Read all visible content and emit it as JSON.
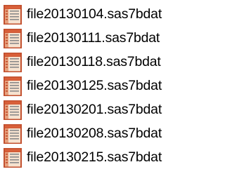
{
  "file_list": {
    "icon": "sas-dataset-icon",
    "colors": {
      "icon_frame": "#c2502e",
      "icon_header": "#d9603a",
      "icon_body": "#f6e2cf",
      "icon_lines": "#8a8a8a",
      "text": "#000000",
      "background": "#ffffff"
    },
    "items": [
      {
        "name": "file20130104.sas7bdat"
      },
      {
        "name": "file20130111.sas7bdat"
      },
      {
        "name": "file20130118.sas7bdat"
      },
      {
        "name": "file20130125.sas7bdat"
      },
      {
        "name": "file20130201.sas7bdat"
      },
      {
        "name": "file20130208.sas7bdat"
      },
      {
        "name": "file20130215.sas7bdat"
      }
    ]
  }
}
